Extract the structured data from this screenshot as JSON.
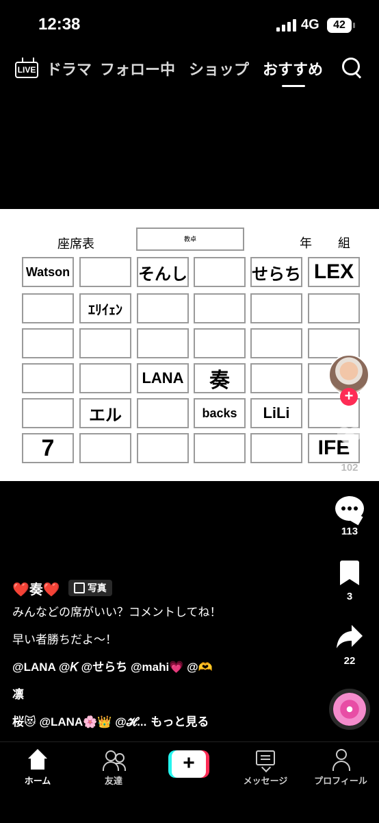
{
  "status_bar": {
    "time": "12:38",
    "network": "4G",
    "battery": "42"
  },
  "top_nav": {
    "live_label": "LIVE",
    "tabs": [
      {
        "label": "ドラマ"
      },
      {
        "label": "フォロー中"
      },
      {
        "label": "ショップ"
      },
      {
        "label": "おすすめ",
        "active": true
      }
    ]
  },
  "photo": {
    "title": "座席表",
    "teacher_desk": "教卓",
    "year_label": "年",
    "class_label": "組",
    "seats": [
      [
        "Watson",
        "",
        "そんし",
        "",
        "せらち",
        "LEX"
      ],
      [
        "",
        "ｴﾘｲｪﾝ",
        "",
        "",
        "",
        ""
      ],
      [
        "",
        "",
        "",
        "",
        "",
        ""
      ],
      [
        "",
        "",
        "LANA",
        "奏",
        "",
        ""
      ],
      [
        "",
        "エル",
        "",
        "backs",
        "LiLi",
        ""
      ],
      [
        "7",
        "",
        "",
        "",
        "",
        "IFE"
      ]
    ]
  },
  "right_rail": {
    "like_count": "102",
    "comment_count": "113",
    "bookmark_count": "3",
    "share_count": "22"
  },
  "caption": {
    "author": "❤️奏❤️",
    "badge": "写真",
    "lines": [
      "みんなどの席がいい？コメントしてね！",
      "早い者勝ちだよ〜！",
      "@LANA @𝐾 @せらち @mahi💗 @🫶",
      "凛",
      "桜😻 @LANA🌸👑 @𝓗..."
    ],
    "more": "もっと見る"
  },
  "bottom_nav": {
    "home": "ホーム",
    "friends": "友達",
    "create": "+",
    "messages": "メッセージ",
    "profile": "プロフィール"
  },
  "colors": {
    "accent_red": "#fe2c55",
    "accent_cyan": "#25f4ee",
    "background": "#000000"
  }
}
